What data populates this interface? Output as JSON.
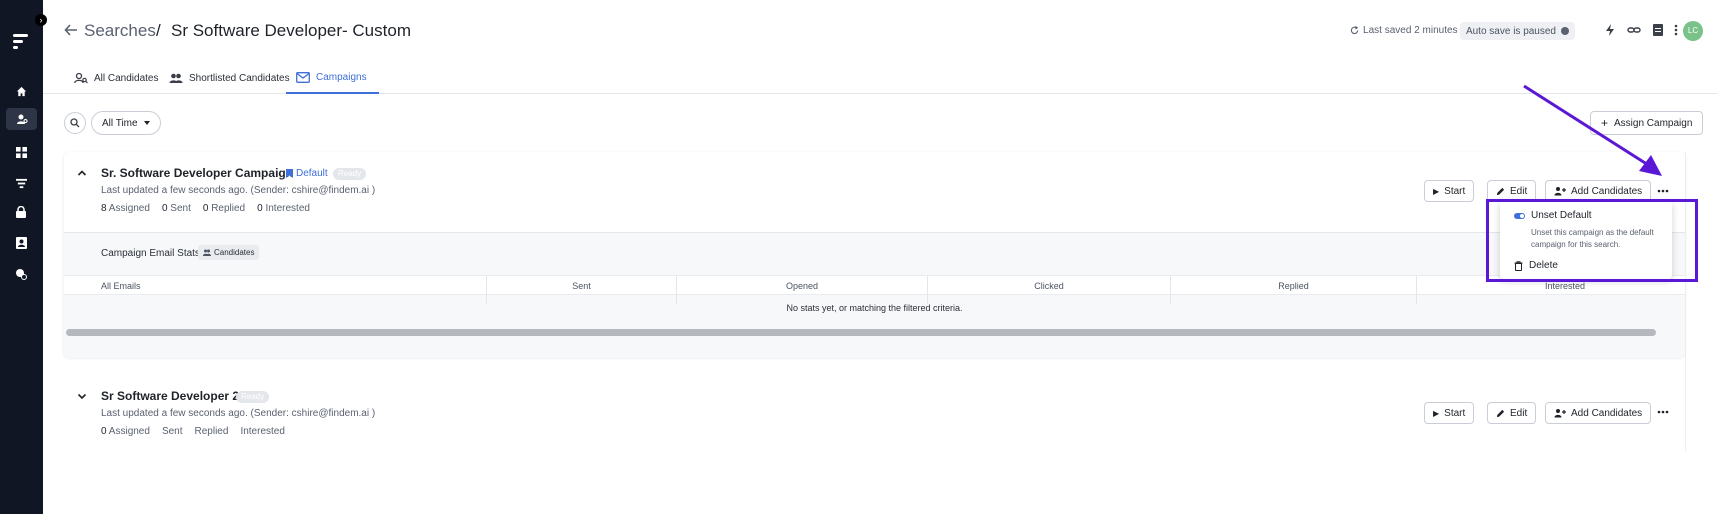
{
  "header": {
    "breadcrumb_link": "Searches",
    "breadcrumb_sep": "/",
    "title": "Sr Software Developer- Custom",
    "last_saved": "Last saved 2 minutes ago",
    "autosave": "Auto save is paused",
    "avatar_initials": "LC"
  },
  "tabs": [
    {
      "label": "All Candidates"
    },
    {
      "label": "Shortlisted Candidates"
    },
    {
      "label": "Campaigns"
    }
  ],
  "toolbar": {
    "time_filter": "All Time",
    "assign_campaign": "Assign Campaign"
  },
  "campaigns": [
    {
      "title": "Sr. Software Developer Campaign",
      "default_label": "Default",
      "status": "Ready",
      "updated": "Last updated a few seconds ago. (Sender: cshire@findem.ai )",
      "assigned_count": "8",
      "assigned_label": "Assigned",
      "sent_count": "0",
      "sent_label": "Sent",
      "replied_count": "0",
      "replied_label": "Replied",
      "interested_count": "0",
      "interested_label": "Interested",
      "start": "Start",
      "edit": "Edit",
      "add_candidates": "Add Candidates"
    },
    {
      "title": "Sr Software Developer 2",
      "status": "Ready",
      "updated": "Last updated a few seconds ago. (Sender: cshire@findem.ai )",
      "assigned_count": "0",
      "assigned_label": "Assigned",
      "sent_label": "Sent",
      "replied_label": "Replied",
      "interested_label": "Interested",
      "start": "Start",
      "edit": "Edit",
      "add_candidates": "Add Candidates"
    }
  ],
  "stats_panel": {
    "title": "Campaign Email Stats",
    "chip": "Candidates",
    "columns": [
      "All Emails",
      "Sent",
      "Opened",
      "Clicked",
      "Replied",
      "Interested"
    ],
    "empty": "No stats yet, or matching the filtered criteria."
  },
  "menu": {
    "unset_default": "Unset Default",
    "unset_desc": "Unset this campaign as the default campaign for this search.",
    "delete": "Delete"
  },
  "colors": {
    "sidebar": "#101624",
    "accent": "#3f6fd8",
    "annotation": "#5a18d6"
  }
}
